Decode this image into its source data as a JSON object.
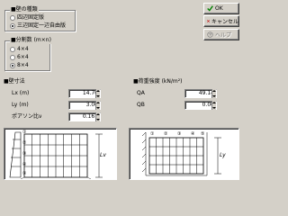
{
  "wall_type": {
    "label": "■壁の種類",
    "options": [
      {
        "label": "四辺固定版",
        "selected": false
      },
      {
        "label": "三辺固定一辺自由版",
        "selected": true
      }
    ]
  },
  "division": {
    "label": "■分割数 (m×n)",
    "options": [
      {
        "label": "4×4",
        "selected": false
      },
      {
        "label": "6×4",
        "selected": false
      },
      {
        "label": "8×4",
        "selected": true
      }
    ]
  },
  "dimensions": {
    "label": "■壁寸法",
    "lx_label": "Lx (m)",
    "lx_value": "14.70",
    "ly_label": "Ly (m)",
    "ly_value": "3.00",
    "poisson_label": "ポアソン比ν",
    "poisson_value": "0.167"
  },
  "load": {
    "label": "■荷重強度 (kN/m²)",
    "qa_label": "QA",
    "qa_value": "49.14",
    "qb_label": "QB",
    "qb_value": "0.00"
  },
  "buttons": {
    "ok": "OK",
    "cancel": "キャンセル",
    "help": "ヘルプ"
  },
  "diagrams": {
    "left_grid_numbers": [
      "①",
      "②",
      "③",
      "④",
      "⑤"
    ],
    "left_dim_label": "Lv",
    "right_grid_numbers": [
      "①",
      "②",
      "③",
      "④",
      "⑤"
    ],
    "right_dim_label": "Ly"
  },
  "colors": {
    "face": "#d4d0c8",
    "ok_check": "#008000",
    "cancel_x": "#c00000"
  }
}
